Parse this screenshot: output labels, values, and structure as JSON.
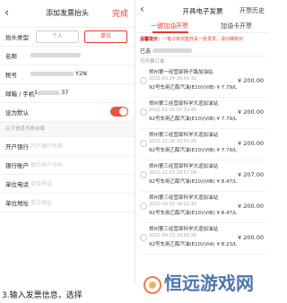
{
  "left": {
    "title": "添加发票抬头",
    "done": "完成",
    "type_label": "抬头类型",
    "type_options": [
      "个人",
      "单位"
    ],
    "name_label": "名称",
    "tax_label": "税号",
    "tax_value_suffix": "Y2N",
    "contact_label": "邮箱 / 手机",
    "contact_value_prefix": "1",
    "contact_value_suffix": "37",
    "default_label": "设为默认",
    "optional_note": "以下信息为非必填",
    "bank_label": "开户银行",
    "bank_placeholder": "开户银行名称",
    "account_label": "银行账户",
    "account_placeholder": "银行账户号码",
    "phone_label": "单位电话",
    "phone_placeholder": "单位电话",
    "address_label": "单位地址",
    "address_placeholder": "单位地址"
  },
  "right": {
    "title": "开具电子发票",
    "history": "开票历史",
    "tabs": [
      "一键加油开票",
      "加油卡开票"
    ],
    "notice_prefix": "温馨提示：",
    "notice_text": "一笔订单仅能开具一张发票，请仔细核对",
    "selected_prefix": "已选",
    "list_header": "可开票订单",
    "orders": [
      {
        "station": "郑州第一经营部扬子路加油站",
        "time": "2022-03-24 16:04:31",
        "product": "92号车用乙醇汽油(E10)(VIB)  ¥ 7.79/L",
        "amount": "¥ 200.00"
      },
      {
        "station": "郑州第三经营部科学大道加油站",
        "time": "2022-01-10 07:32:45",
        "product": "92号车用乙醇汽油(E10)(VIB)  ¥ 7.79/L",
        "amount": "¥ 200.00"
      },
      {
        "station": "郑州第三经营部科学大道加油站",
        "time": "2021-12-30 10:07:29",
        "product": "92号车用乙醇汽油(E10)(VIB)  ¥ 7.79/L",
        "amount": "¥ 200.00"
      },
      {
        "station": "郑州第三经营部科学大道加油站",
        "time": "2021-11-03 19:57:09",
        "product": "92号车用乙醇汽油(E10)(VIB)  ¥ 8.47/L",
        "amount": "¥ 207.00"
      },
      {
        "station": "郑州第三经营部科学大道加油站",
        "time": "2021-10-15 18:22:10",
        "product": "92号车用乙醇汽油(E10)(VIB)  ¥ 8.47/L",
        "amount": "¥ 200.00"
      },
      {
        "station": "郑州第三经营部科学大道加油站",
        "time": "2021-09-23 19:43:28",
        "product": "92号车用乙醇汽油(E10)(VIA)  ¥ 8.23/L",
        "amount": "¥ 200.00"
      }
    ]
  },
  "caption": "3.输入发票信息，选择",
  "watermark": "恒远游戏网"
}
